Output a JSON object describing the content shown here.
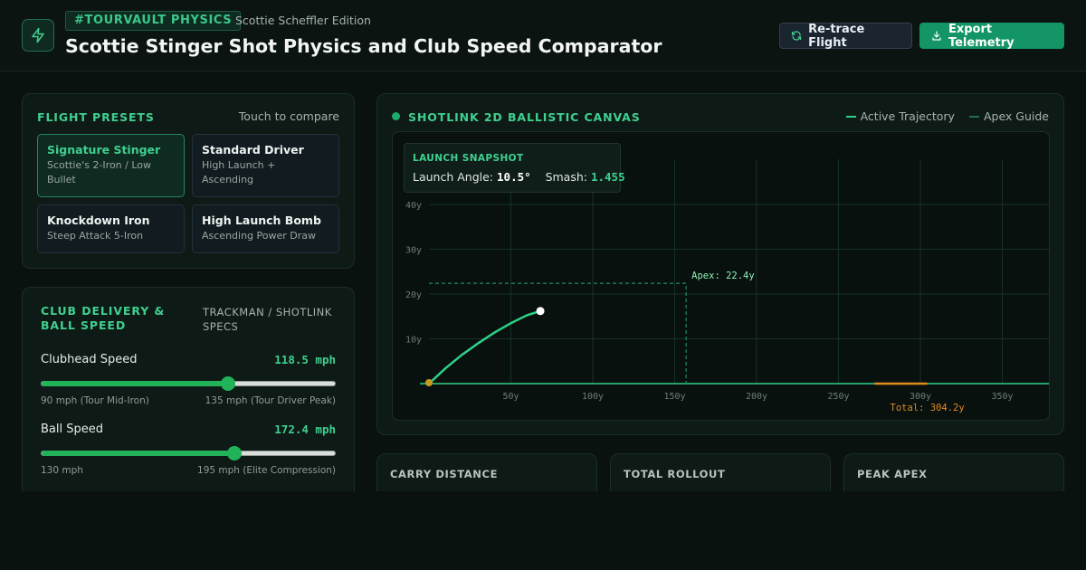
{
  "header": {
    "tag": "#TOURVAULT PHYSICS",
    "edition": "Scottie Scheffler Edition",
    "title": "Scottie Stinger Shot Physics and Club Speed Comparator",
    "retrace_label": "Re-trace Flight",
    "export_label": "Export Telemetry",
    "logo_icon": "bolt-icon"
  },
  "presets": {
    "title": "FLIGHT PRESETS",
    "hint": "Touch to compare",
    "items": [
      {
        "name": "Signature Stinger",
        "desc": "Scottie's 2-Iron / Low Bullet",
        "active": true
      },
      {
        "name": "Standard Driver",
        "desc": "High Launch + Ascending",
        "active": false
      },
      {
        "name": "Knockdown Iron",
        "desc": "Steep Attack 5-Iron",
        "active": false
      },
      {
        "name": "High Launch Bomb",
        "desc": "Ascending Power Draw",
        "active": false
      }
    ]
  },
  "club": {
    "title": "CLUB DELIVERY & BALL SPEED",
    "specs": "TRACKMAN / SHOTLINK SPECS",
    "clubhead": {
      "label": "Clubhead Speed",
      "value": "118.5 mph",
      "min_label": "90 mph (Tour Mid-Iron)",
      "max_label": "135 mph (Tour Driver Peak)",
      "min": 90,
      "max": 135,
      "current": 118.5
    },
    "ball": {
      "label": "Ball Speed",
      "value": "172.4 mph",
      "min_label": "130 mph",
      "max_label": "195 mph (Elite Compression)",
      "min": 130,
      "max": 195,
      "current": 172.4
    }
  },
  "canvas": {
    "title": "SHOTLINK 2D BALLISTIC CANVAS",
    "legend_active": "Active Trajectory",
    "legend_apex": "Apex Guide",
    "snapshot_title": "LAUNCH SNAPSHOT",
    "launch_angle_label": "Launch Angle:",
    "launch_angle": "10.5°",
    "smash_label": "Smash:",
    "smash": "1.455",
    "apex_label": "Apex: 22.4y",
    "total_label": "Total: 304.2y",
    "colors": {
      "trajectory": "#2fd08a",
      "apex": "#1f8a5e",
      "total": "#e38a1e"
    }
  },
  "chart_data": {
    "type": "line",
    "x_ticks": [
      "50y",
      "100y",
      "150y",
      "200y",
      "250y",
      "300y",
      "350y"
    ],
    "y_ticks": [
      "10y",
      "20y",
      "30y",
      "40y"
    ],
    "xlim": [
      0,
      380
    ],
    "ylim": [
      0,
      45
    ],
    "apex_x": 157,
    "apex_y": 22.4,
    "total": 304.2,
    "rollout_start": 272,
    "series": [
      {
        "x": [
          0,
          10,
          20,
          30,
          40,
          50,
          60,
          68
        ],
        "y": [
          0,
          3.4,
          6.4,
          9.0,
          11.4,
          13.5,
          15.3,
          16.2
        ]
      }
    ]
  },
  "stats": [
    {
      "label": "CARRY DISTANCE"
    },
    {
      "label": "TOTAL ROLLOUT"
    },
    {
      "label": "PEAK APEX"
    }
  ]
}
